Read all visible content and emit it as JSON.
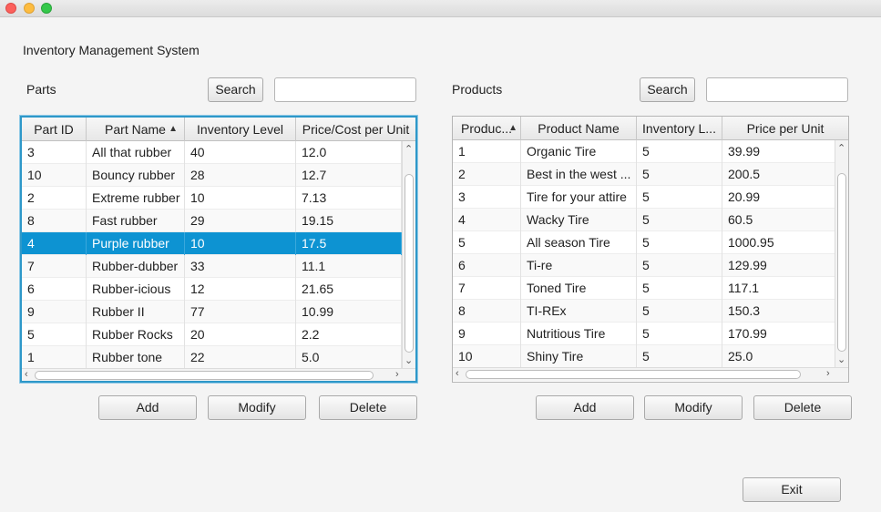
{
  "app": {
    "title": "Inventory Management System"
  },
  "parts": {
    "label": "Parts",
    "search_label": "Search",
    "search_value": "",
    "columns": [
      "Part ID",
      "Part Name",
      "Inventory Level",
      "Price/Cost per Unit"
    ],
    "sorted_column": 1,
    "rows": [
      [
        "3",
        "All that rubber",
        "40",
        "12.0"
      ],
      [
        "10",
        "Bouncy rubber",
        "28",
        "12.7"
      ],
      [
        "2",
        "Extreme rubber",
        "10",
        "7.13"
      ],
      [
        "8",
        "Fast rubber",
        "29",
        "19.15"
      ],
      [
        "4",
        "Purple rubber",
        "10",
        "17.5"
      ],
      [
        "7",
        "Rubber-dubber",
        "33",
        "11.1"
      ],
      [
        "6",
        "Rubber-icious",
        "12",
        "21.65"
      ],
      [
        "9",
        "Rubber II",
        "77",
        "10.99"
      ],
      [
        "5",
        "Rubber Rocks",
        "20",
        "2.2"
      ],
      [
        "1",
        "Rubber tone",
        "22",
        "5.0"
      ]
    ],
    "selected_row": 4,
    "add_label": "Add",
    "modify_label": "Modify",
    "delete_label": "Delete"
  },
  "products": {
    "label": "Products",
    "search_label": "Search",
    "search_value": "",
    "columns": [
      "Produc...",
      "Product Name",
      "Inventory L...",
      "Price per Unit"
    ],
    "sorted_column": 0,
    "rows": [
      [
        "1",
        "Organic Tire",
        "5",
        "39.99"
      ],
      [
        "2",
        "Best in the west ...",
        "5",
        "200.5"
      ],
      [
        "3",
        "Tire for your attire",
        "5",
        "20.99"
      ],
      [
        "4",
        "Wacky Tire",
        "5",
        "60.5"
      ],
      [
        "5",
        "All season Tire",
        "5",
        "1000.95"
      ],
      [
        "6",
        "Ti-re",
        "5",
        "129.99"
      ],
      [
        "7",
        "Toned Tire",
        "5",
        "117.1"
      ],
      [
        "8",
        "TI-REx",
        "5",
        "150.3"
      ],
      [
        "9",
        "Nutritious Tire",
        "5",
        "170.99"
      ],
      [
        "10",
        "Shiny Tire",
        "5",
        "25.0"
      ]
    ],
    "add_label": "Add",
    "modify_label": "Modify",
    "delete_label": "Delete"
  },
  "exit_label": "Exit",
  "icons": {
    "sort_up": "▲",
    "scroll_up": "⌃",
    "scroll_down": "⌄",
    "scroll_left": "‹",
    "scroll_right": "›"
  },
  "colors": {
    "selection": "#0d93d2",
    "focus_border": "#2e98c9"
  }
}
